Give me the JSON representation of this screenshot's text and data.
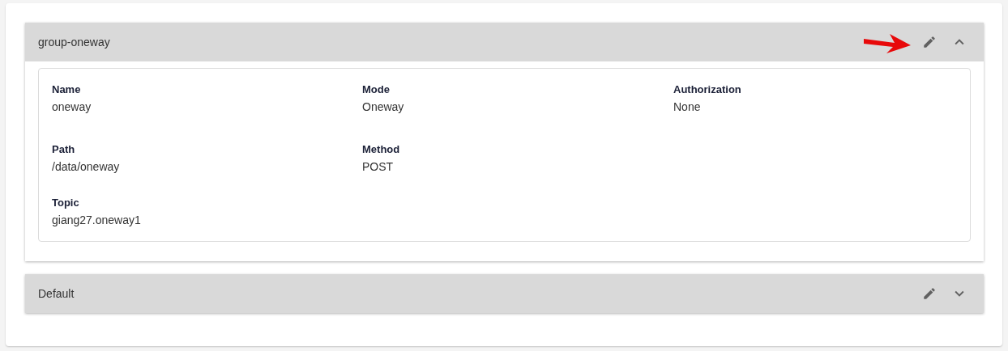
{
  "panels": [
    {
      "title": "group-oneway",
      "expanded": true,
      "edit_highlighted": true,
      "rows": [
        [
          {
            "label": "Name",
            "value": "oneway"
          },
          {
            "label": "Mode",
            "value": "Oneway"
          },
          {
            "label": "Authorization",
            "value": "None"
          }
        ],
        [
          {
            "label": "Path",
            "value": "/data/oneway"
          },
          {
            "label": "Method",
            "value": "POST"
          }
        ],
        [
          {
            "label": "Topic",
            "value": "giang27.oneway1"
          }
        ]
      ]
    },
    {
      "title": "Default",
      "expanded": false,
      "edit_highlighted": false
    }
  ]
}
